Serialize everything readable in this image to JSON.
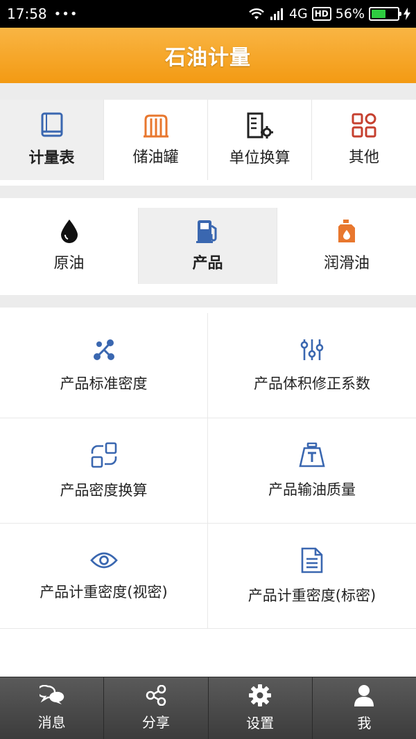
{
  "status_bar": {
    "time": "17:58",
    "dots": "•••",
    "network": "4G",
    "hd": "HD",
    "battery_percent": "56%",
    "battery_level": 0.56
  },
  "header": {
    "title": "石油计量"
  },
  "top_tabs": [
    {
      "label": "计量表",
      "icon": "book-icon",
      "active": true
    },
    {
      "label": "储油罐",
      "icon": "tank-icon",
      "active": false
    },
    {
      "label": "单位换算",
      "icon": "conversion-icon",
      "active": false
    },
    {
      "label": "其他",
      "icon": "grid-icon",
      "active": false
    }
  ],
  "sub_tabs": [
    {
      "label": "原油",
      "icon": "oil-drop-icon",
      "active": false
    },
    {
      "label": "产品",
      "icon": "fuel-pump-icon",
      "active": true
    },
    {
      "label": "润滑油",
      "icon": "oil-can-icon",
      "active": false
    }
  ],
  "grid_items": [
    {
      "label": "产品标准密度",
      "icon": "molecule-icon"
    },
    {
      "label": "产品体积修正系数",
      "icon": "sliders-icon"
    },
    {
      "label": "产品密度换算",
      "icon": "transform-icon"
    },
    {
      "label": "产品输油质量",
      "icon": "weight-icon"
    },
    {
      "label": "产品计重密度(视密)",
      "icon": "eye-icon"
    },
    {
      "label": "产品计重密度(标密)",
      "icon": "document-icon"
    }
  ],
  "bottom_nav": [
    {
      "label": "消息",
      "icon": "chat-icon"
    },
    {
      "label": "分享",
      "icon": "share-icon"
    },
    {
      "label": "设置",
      "icon": "gear-icon"
    },
    {
      "label": "我",
      "icon": "user-icon"
    }
  ],
  "colors": {
    "accent_orange": "#f39a13",
    "icon_blue": "#3a67b0",
    "icon_orange": "#e8772e",
    "icon_red": "#c6402f",
    "nav_bg": "#444444"
  }
}
